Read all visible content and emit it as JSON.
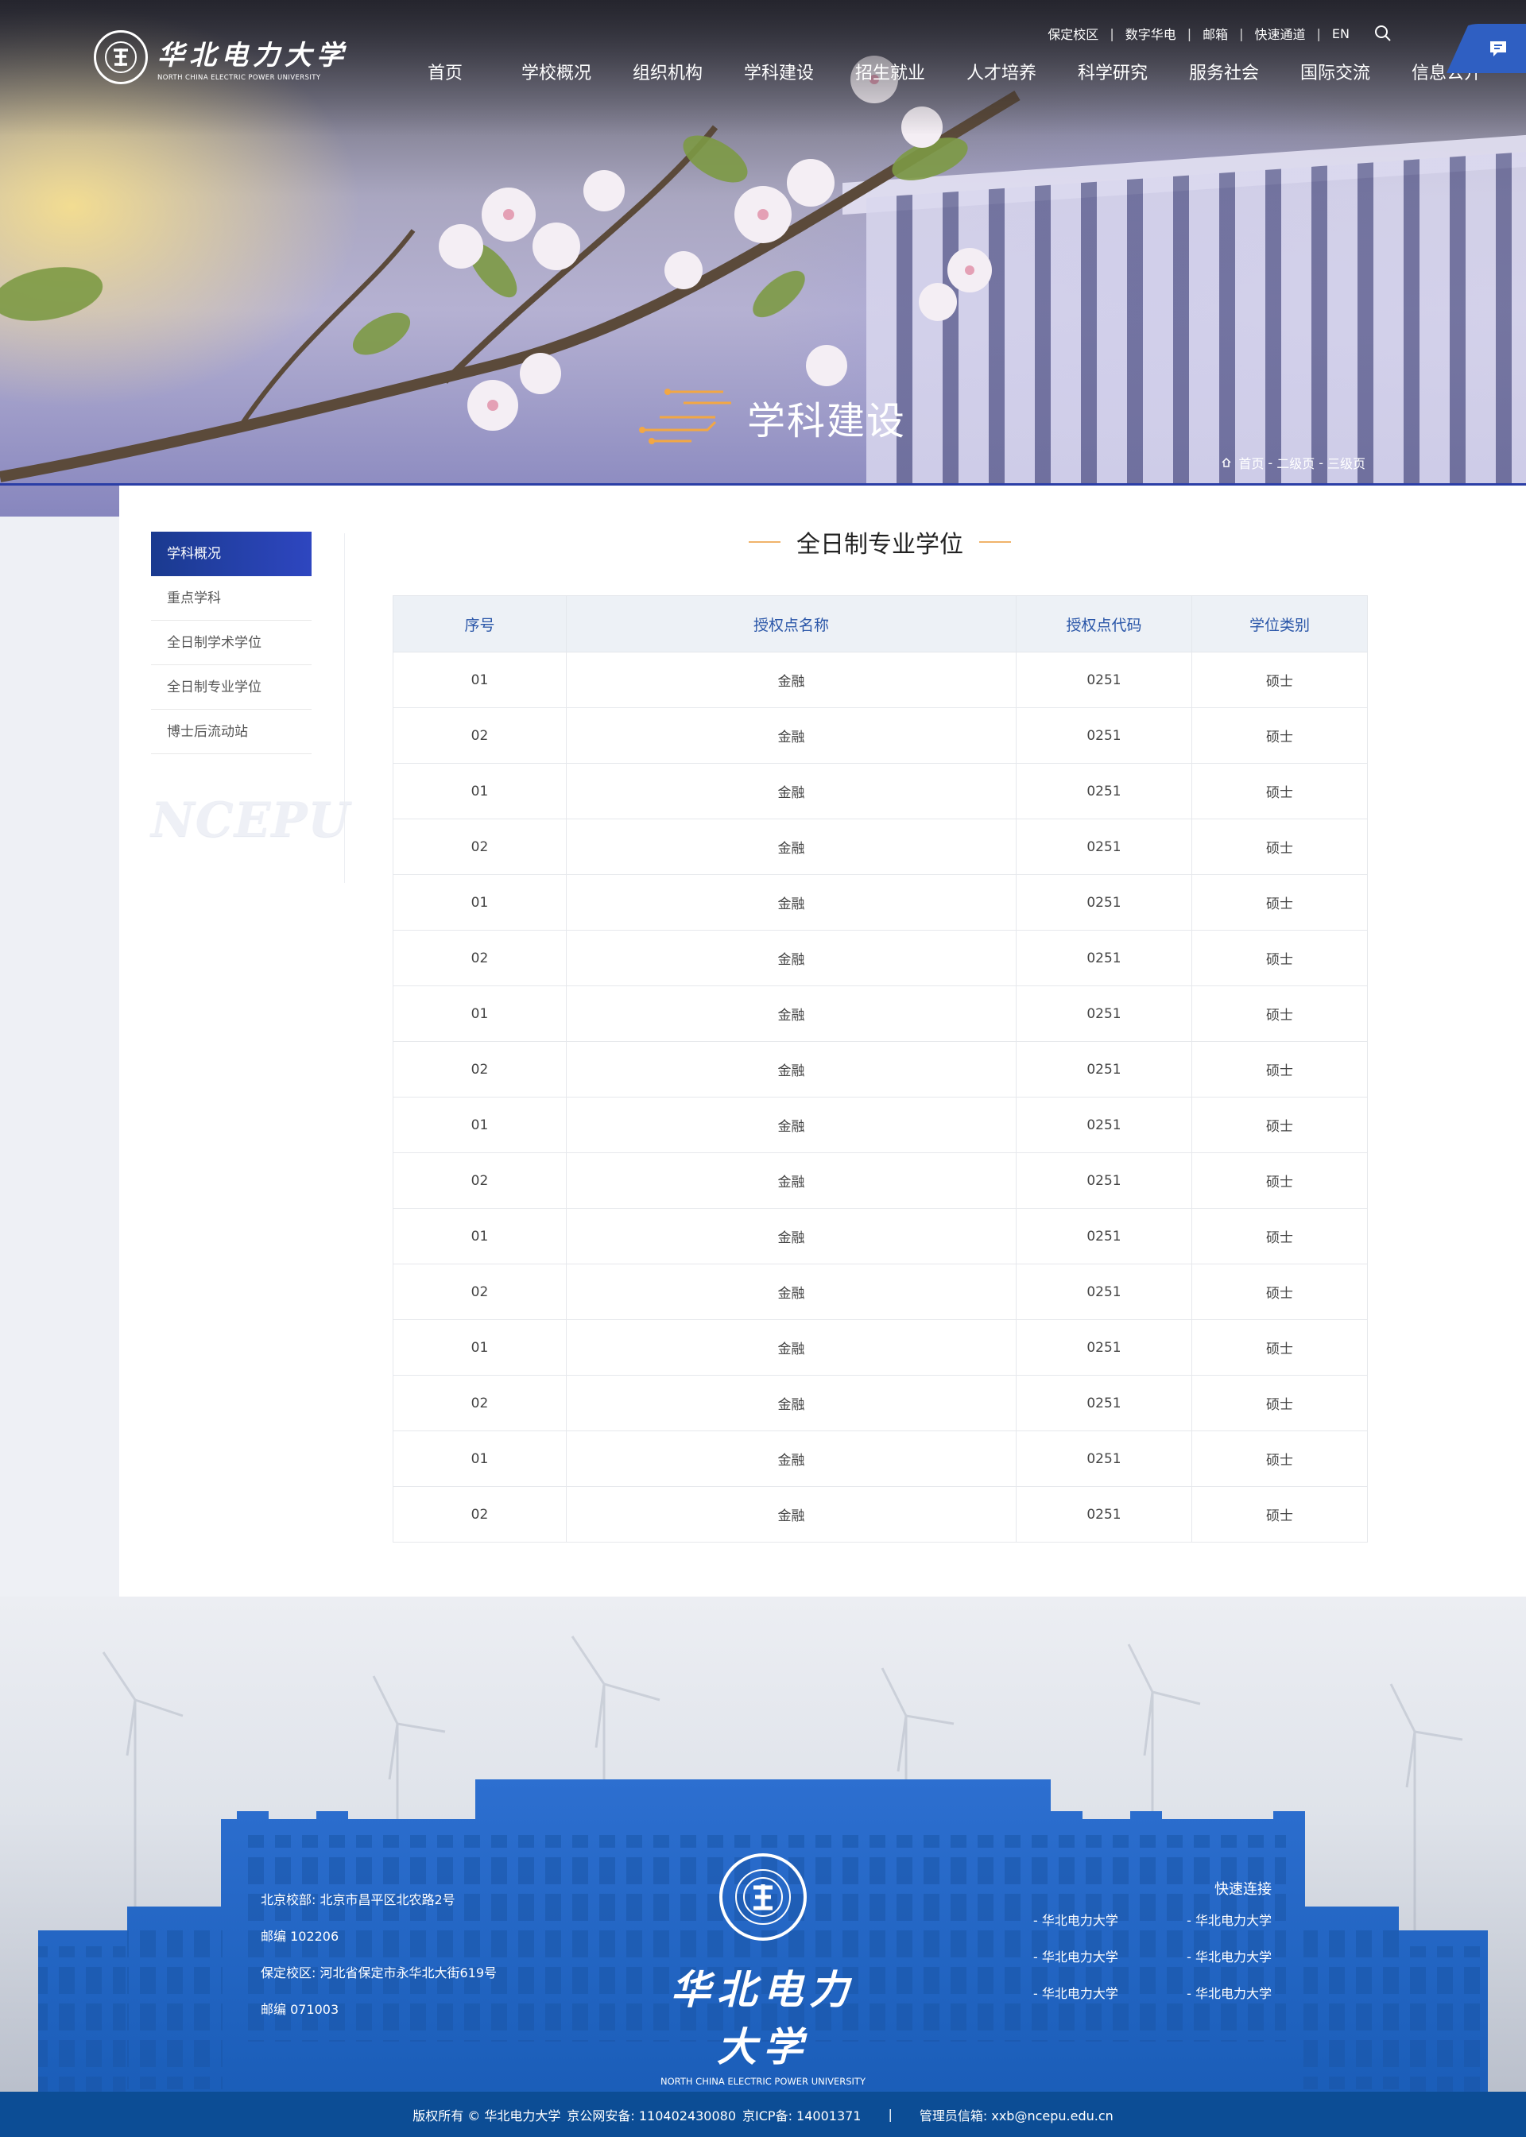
{
  "header": {
    "logo": {
      "cn": "华北电力大学",
      "en": "NORTH CHINA ELECTRIC POWER UNIVERSITY"
    },
    "utility_links": [
      "保定校区",
      "数字华电",
      "邮箱",
      "快速通道",
      "EN"
    ],
    "nav": [
      "首页",
      "学校概况",
      "组织机构",
      "学科建设",
      "招生就业",
      "人才培养",
      "科学研究",
      "服务社会",
      "国际交流",
      "信息公开"
    ]
  },
  "hero": {
    "title": "学科建设",
    "breadcrumb": [
      "首页",
      "二级页",
      "三级页"
    ]
  },
  "sidebar": {
    "items": [
      "学科概况",
      "重点学科",
      "全日制学术学位",
      "全日制专业学位",
      "博士后流动站"
    ],
    "active_index": 0,
    "watermark": "NCEPU"
  },
  "main": {
    "section_title": "全日制专业学位",
    "table": {
      "columns": [
        "序号",
        "授权点名称",
        "授权点代码",
        "学位类别"
      ],
      "rows": [
        [
          "01",
          "金融",
          "0251",
          "硕士"
        ],
        [
          "02",
          "金融",
          "0251",
          "硕士"
        ],
        [
          "01",
          "金融",
          "0251",
          "硕士"
        ],
        [
          "02",
          "金融",
          "0251",
          "硕士"
        ],
        [
          "01",
          "金融",
          "0251",
          "硕士"
        ],
        [
          "02",
          "金融",
          "0251",
          "硕士"
        ],
        [
          "01",
          "金融",
          "0251",
          "硕士"
        ],
        [
          "02",
          "金融",
          "0251",
          "硕士"
        ],
        [
          "01",
          "金融",
          "0251",
          "硕士"
        ],
        [
          "02",
          "金融",
          "0251",
          "硕士"
        ],
        [
          "01",
          "金融",
          "0251",
          "硕士"
        ],
        [
          "02",
          "金融",
          "0251",
          "硕士"
        ],
        [
          "01",
          "金融",
          "0251",
          "硕士"
        ],
        [
          "02",
          "金融",
          "0251",
          "硕士"
        ],
        [
          "01",
          "金融",
          "0251",
          "硕士"
        ],
        [
          "02",
          "金融",
          "0251",
          "硕士"
        ]
      ]
    }
  },
  "footer": {
    "address_lines": [
      "北京校部: 北京市昌平区北农路2号",
      "邮编 102206",
      "保定校区: 河北省保定市永华北大街619号",
      "邮编 071003"
    ],
    "name_cn": "华北电力大学",
    "name_en": "NORTH CHINA ELECTRIC POWER UNIVERSITY",
    "quick_title": "快速连接",
    "quick_links": [
      "- 华北电力大学",
      "- 华北电力大学",
      "- 华北电力大学",
      "- 华北电力大学",
      "- 华北电力大学",
      "- 华北电力大学"
    ],
    "copyright": {
      "owner": "版权所有 © 华北电力大学",
      "police": "京公网安备: 110402430080",
      "icp": "京ICP备: 14001371",
      "separator": "|",
      "admin": "管理员信箱: xxb@ncepu.edu.cn"
    }
  },
  "colors": {
    "primary_blue": "#1f5fbf",
    "active_nav_gradient": "#2e46c0",
    "table_header_text": "#2a56a8",
    "title_accent": "#f0b36a",
    "copyright_bar": "#0c4d95"
  }
}
